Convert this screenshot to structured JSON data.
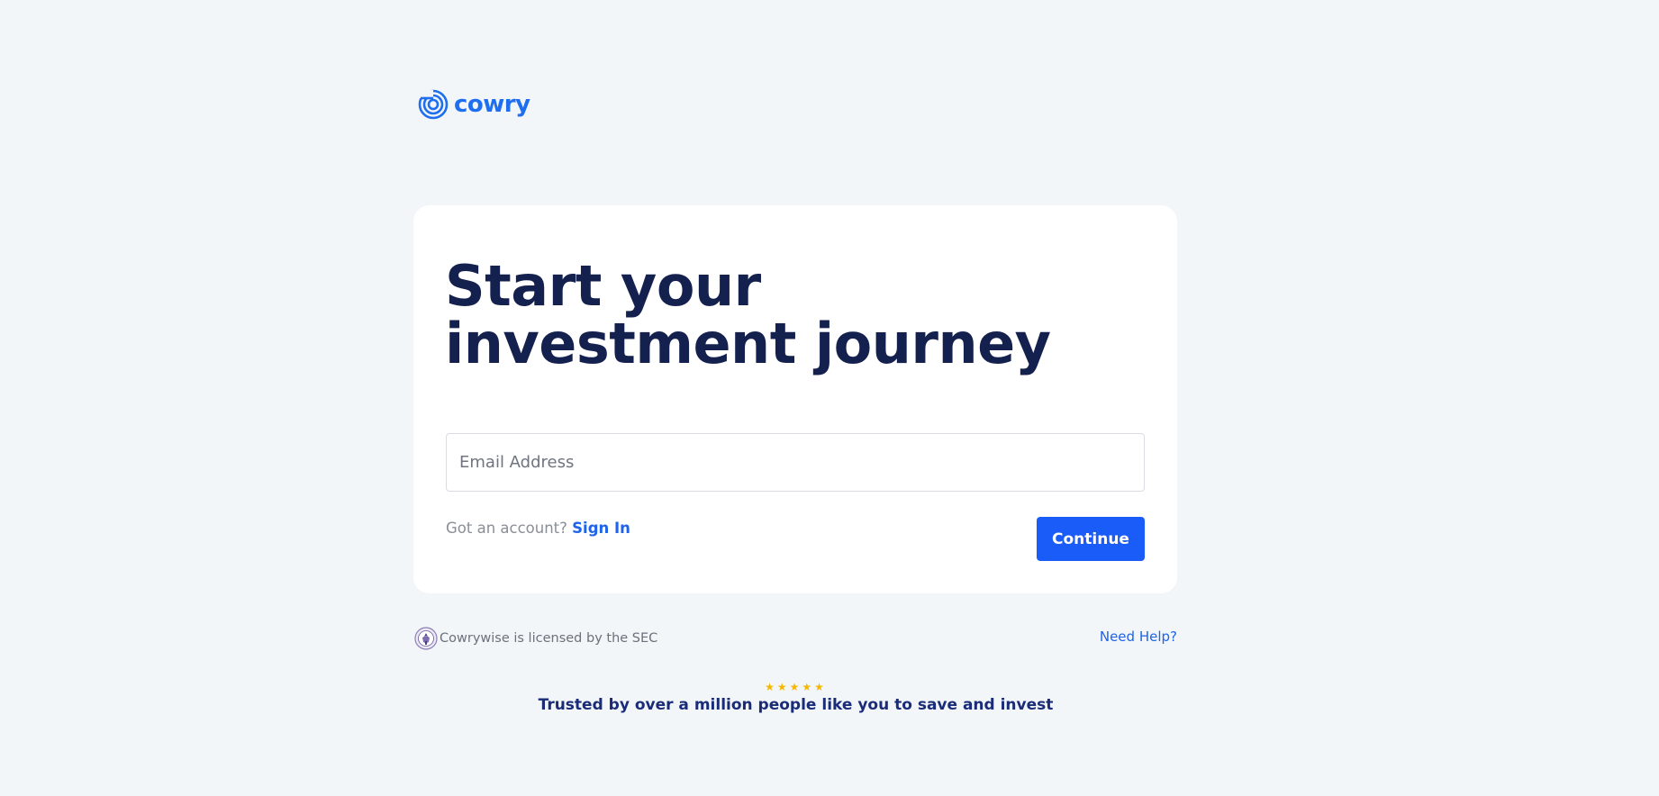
{
  "brand": {
    "name": "cowry",
    "color": "#1e6ff0"
  },
  "signup": {
    "heading": "Start your investment journey",
    "email_placeholder": "Email Address",
    "account_prompt": "Got an account?",
    "signin_label": "Sign In",
    "continue_label": "Continue"
  },
  "footer": {
    "license_text": "Cowrywise is licensed by the SEC",
    "help_label": "Need Help?",
    "stars": "★★★★★",
    "trusted_text": "Trusted by over a million people like you to save and invest"
  },
  "colors": {
    "background": "#f2f6f9",
    "heading": "#14214e",
    "button": "#1a5cf7",
    "link": "#1e63e9",
    "star": "#f5b800"
  },
  "icons": {
    "logo": "cowry-logo-icon",
    "seal": "sec-seal-icon"
  }
}
